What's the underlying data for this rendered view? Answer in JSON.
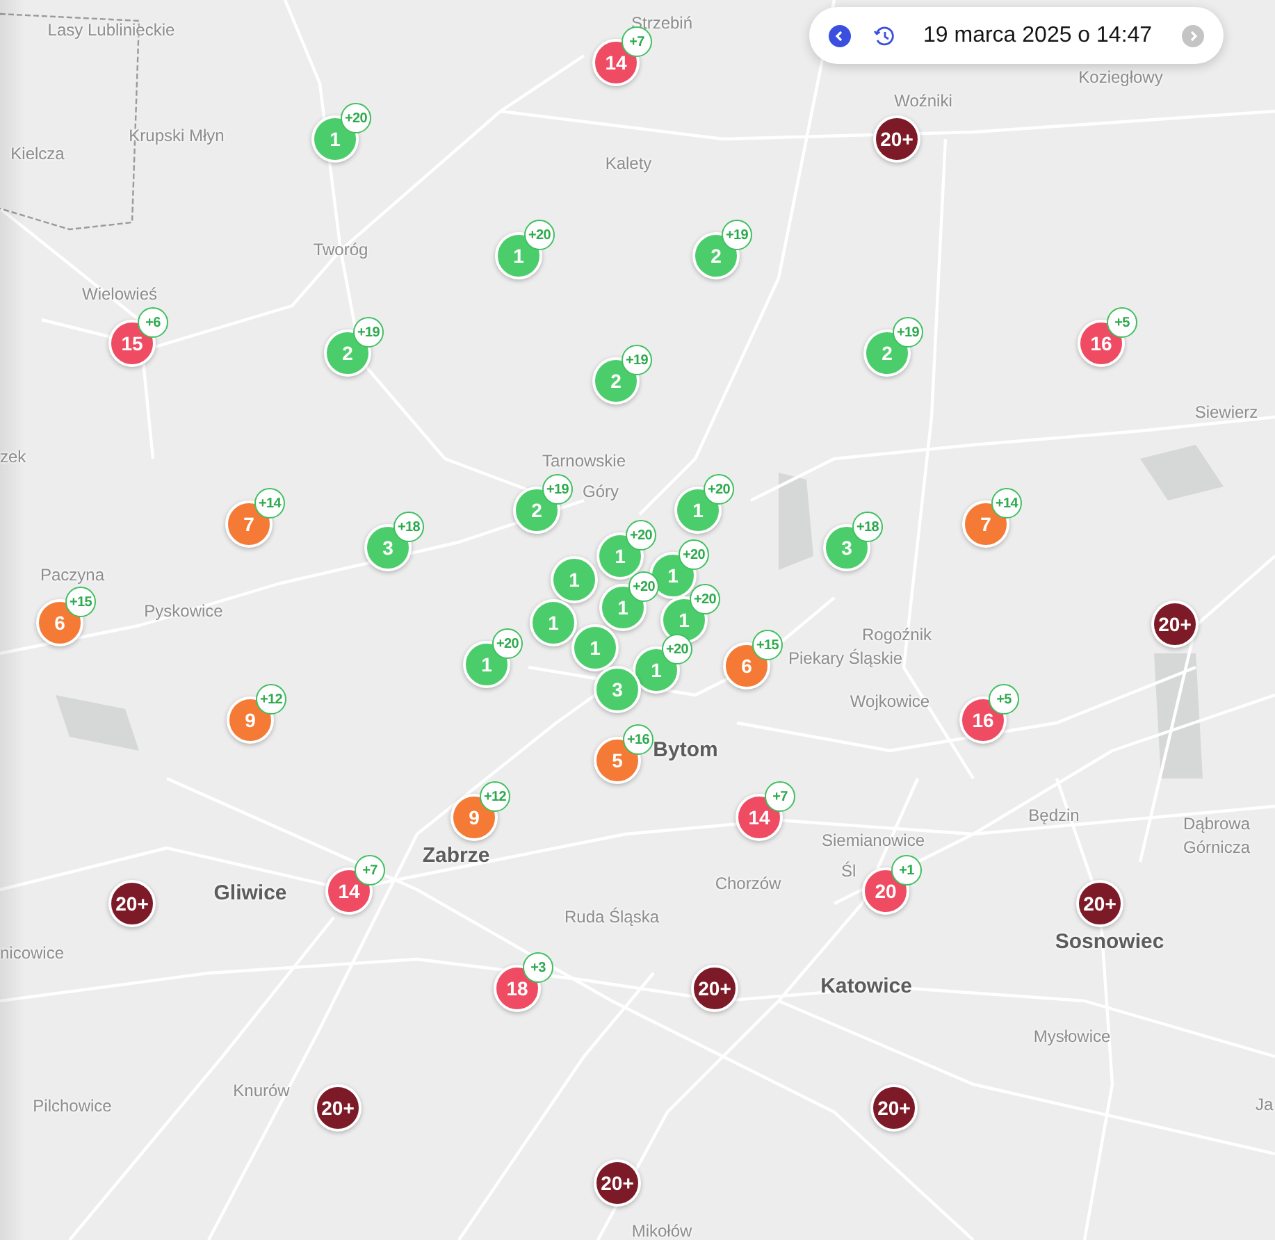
{
  "date_control": {
    "label": "19 marca 2025 o 14:47",
    "prev_disabled": false,
    "next_disabled": true
  },
  "markers": [
    {
      "count": "14",
      "color": "#ef4b63",
      "badge": "+7"
    },
    {
      "count": "1",
      "color": "#4ccd6b",
      "badge": "+20"
    },
    {
      "count": "20+",
      "color": "#7d1a28"
    },
    {
      "count": "1",
      "color": "#4ccd6b",
      "badge": "+20"
    },
    {
      "count": "2",
      "color": "#4ccd6b",
      "badge": "+19"
    },
    {
      "count": "15",
      "color": "#ef4b63",
      "badge": "+6"
    },
    {
      "count": "2",
      "color": "#4ccd6b",
      "badge": "+19"
    },
    {
      "count": "2",
      "color": "#4ccd6b",
      "badge": "+19"
    },
    {
      "count": "2",
      "color": "#4ccd6b",
      "badge": "+19"
    },
    {
      "count": "16",
      "color": "#ef4b63",
      "badge": "+5"
    },
    {
      "count": "7",
      "color": "#f47a35",
      "badge": "+14"
    },
    {
      "count": "3",
      "color": "#4ccd6b",
      "badge": "+18"
    },
    {
      "count": "2",
      "color": "#4ccd6b",
      "badge": "+19"
    },
    {
      "count": "1",
      "color": "#4ccd6b",
      "badge": "+20"
    },
    {
      "count": "3",
      "color": "#4ccd6b",
      "badge": "+18"
    },
    {
      "count": "7",
      "color": "#f47a35",
      "badge": "+14"
    },
    {
      "count": "1",
      "color": "#4ccd6b"
    },
    {
      "count": "1",
      "color": "#4ccd6b",
      "badge": "+20"
    },
    {
      "count": "1",
      "color": "#4ccd6b",
      "badge": "+20"
    },
    {
      "count": "6",
      "color": "#f47a35",
      "badge": "+15"
    },
    {
      "count": "1",
      "color": "#4ccd6b"
    },
    {
      "count": "1",
      "color": "#4ccd6b",
      "badge": "+20"
    },
    {
      "count": "1",
      "color": "#4ccd6b",
      "badge": "+20"
    },
    {
      "count": "20+",
      "color": "#7d1a28"
    },
    {
      "count": "1",
      "color": "#4ccd6b",
      "badge": "+20"
    },
    {
      "count": "1",
      "color": "#4ccd6b"
    },
    {
      "count": "1",
      "color": "#4ccd6b",
      "badge": "+20"
    },
    {
      "count": "6",
      "color": "#f47a35",
      "badge": "+15"
    },
    {
      "count": "3",
      "color": "#4ccd6b"
    },
    {
      "count": "9",
      "color": "#f47a35",
      "badge": "+12"
    },
    {
      "count": "16",
      "color": "#ef4b63",
      "badge": "+5"
    },
    {
      "count": "5",
      "color": "#f47a35",
      "badge": "+16"
    },
    {
      "count": "9",
      "color": "#f47a35",
      "badge": "+12"
    },
    {
      "count": "14",
      "color": "#ef4b63",
      "badge": "+7"
    },
    {
      "count": "20+",
      "color": "#7d1a28"
    },
    {
      "count": "14",
      "color": "#ef4b63",
      "badge": "+7"
    },
    {
      "count": "20",
      "color": "#ef4b63",
      "badge": "+1"
    },
    {
      "count": "20+",
      "color": "#7d1a28"
    },
    {
      "count": "18",
      "color": "#ef4b63",
      "badge": "+3"
    },
    {
      "count": "20+",
      "color": "#7d1a28"
    },
    {
      "count": "20+",
      "color": "#7d1a28"
    },
    {
      "count": "20+",
      "color": "#7d1a28"
    },
    {
      "count": "20+",
      "color": "#7d1a28"
    }
  ],
  "places": [
    {
      "text": "Lasy Lublinieckie",
      "kind": "town"
    },
    {
      "text": "Strzebiń",
      "kind": "town"
    },
    {
      "text": "Koziegłowy",
      "kind": "town"
    },
    {
      "text": "Woźniki",
      "kind": "town"
    },
    {
      "text": "Krupski Młyn",
      "kind": "town"
    },
    {
      "text": "Kielcza",
      "kind": "town"
    },
    {
      "text": "Kalety",
      "kind": "town"
    },
    {
      "text": "Tworóg",
      "kind": "town"
    },
    {
      "text": "Wielowieś",
      "kind": "town"
    },
    {
      "text": "Siewierz",
      "kind": "town"
    },
    {
      "text": "zek",
      "kind": "town"
    },
    {
      "text": "Tarnowskie",
      "kind": "town"
    },
    {
      "text": "Góry",
      "kind": "town"
    },
    {
      "text": "Paczyna",
      "kind": "town"
    },
    {
      "text": "Pyskowice",
      "kind": "town"
    },
    {
      "text": "Rogoźnik",
      "kind": "town"
    },
    {
      "text": "Piekary Śląskie",
      "kind": "town"
    },
    {
      "text": "Wojkowice",
      "kind": "town"
    },
    {
      "text": "Bytom",
      "kind": "city"
    },
    {
      "text": "Będzin",
      "kind": "town"
    },
    {
      "text": "Dąbrowa",
      "kind": "town"
    },
    {
      "text": "Górnicza",
      "kind": "town"
    },
    {
      "text": "Siemianowice",
      "kind": "town"
    },
    {
      "text": "Śl",
      "kind": "town"
    },
    {
      "text": "Zabrze",
      "kind": "city"
    },
    {
      "text": "Chorzów",
      "kind": "town"
    },
    {
      "text": "Gliwice",
      "kind": "city"
    },
    {
      "text": "Sosnowiec",
      "kind": "city"
    },
    {
      "text": "nicowice",
      "kind": "town"
    },
    {
      "text": "Ruda Śląska",
      "kind": "town"
    },
    {
      "text": "Katowice",
      "kind": "city"
    },
    {
      "text": "Mysłowice",
      "kind": "town"
    },
    {
      "text": "Knurów",
      "kind": "town"
    },
    {
      "text": "Pilchowice",
      "kind": "town"
    },
    {
      "text": "Mikołów",
      "kind": "town"
    },
    {
      "text": "Ja",
      "kind": "town"
    }
  ]
}
